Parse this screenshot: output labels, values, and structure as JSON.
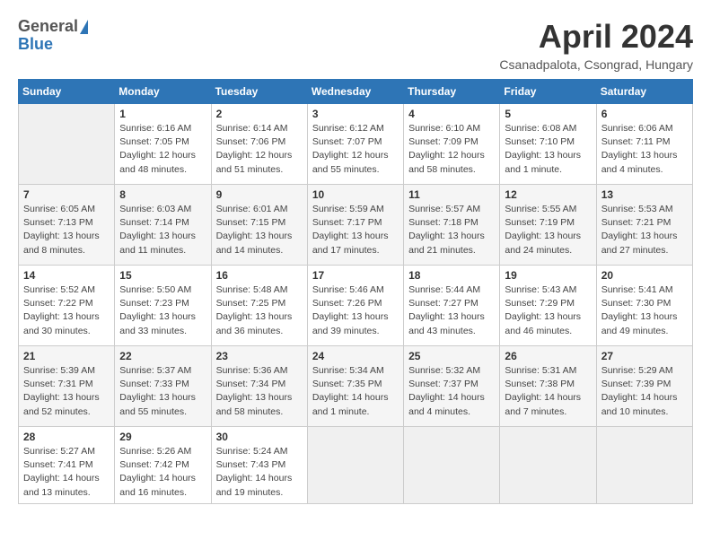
{
  "header": {
    "logo_general": "General",
    "logo_blue": "Blue",
    "month_title": "April 2024",
    "location": "Csanadpalota, Csongrad, Hungary"
  },
  "weekdays": [
    "Sunday",
    "Monday",
    "Tuesday",
    "Wednesday",
    "Thursday",
    "Friday",
    "Saturday"
  ],
  "weeks": [
    [
      {
        "day": "",
        "info": ""
      },
      {
        "day": "1",
        "info": "Sunrise: 6:16 AM\nSunset: 7:05 PM\nDaylight: 12 hours\nand 48 minutes."
      },
      {
        "day": "2",
        "info": "Sunrise: 6:14 AM\nSunset: 7:06 PM\nDaylight: 12 hours\nand 51 minutes."
      },
      {
        "day": "3",
        "info": "Sunrise: 6:12 AM\nSunset: 7:07 PM\nDaylight: 12 hours\nand 55 minutes."
      },
      {
        "day": "4",
        "info": "Sunrise: 6:10 AM\nSunset: 7:09 PM\nDaylight: 12 hours\nand 58 minutes."
      },
      {
        "day": "5",
        "info": "Sunrise: 6:08 AM\nSunset: 7:10 PM\nDaylight: 13 hours\nand 1 minute."
      },
      {
        "day": "6",
        "info": "Sunrise: 6:06 AM\nSunset: 7:11 PM\nDaylight: 13 hours\nand 4 minutes."
      }
    ],
    [
      {
        "day": "7",
        "info": "Sunrise: 6:05 AM\nSunset: 7:13 PM\nDaylight: 13 hours\nand 8 minutes."
      },
      {
        "day": "8",
        "info": "Sunrise: 6:03 AM\nSunset: 7:14 PM\nDaylight: 13 hours\nand 11 minutes."
      },
      {
        "day": "9",
        "info": "Sunrise: 6:01 AM\nSunset: 7:15 PM\nDaylight: 13 hours\nand 14 minutes."
      },
      {
        "day": "10",
        "info": "Sunrise: 5:59 AM\nSunset: 7:17 PM\nDaylight: 13 hours\nand 17 minutes."
      },
      {
        "day": "11",
        "info": "Sunrise: 5:57 AM\nSunset: 7:18 PM\nDaylight: 13 hours\nand 21 minutes."
      },
      {
        "day": "12",
        "info": "Sunrise: 5:55 AM\nSunset: 7:19 PM\nDaylight: 13 hours\nand 24 minutes."
      },
      {
        "day": "13",
        "info": "Sunrise: 5:53 AM\nSunset: 7:21 PM\nDaylight: 13 hours\nand 27 minutes."
      }
    ],
    [
      {
        "day": "14",
        "info": "Sunrise: 5:52 AM\nSunset: 7:22 PM\nDaylight: 13 hours\nand 30 minutes."
      },
      {
        "day": "15",
        "info": "Sunrise: 5:50 AM\nSunset: 7:23 PM\nDaylight: 13 hours\nand 33 minutes."
      },
      {
        "day": "16",
        "info": "Sunrise: 5:48 AM\nSunset: 7:25 PM\nDaylight: 13 hours\nand 36 minutes."
      },
      {
        "day": "17",
        "info": "Sunrise: 5:46 AM\nSunset: 7:26 PM\nDaylight: 13 hours\nand 39 minutes."
      },
      {
        "day": "18",
        "info": "Sunrise: 5:44 AM\nSunset: 7:27 PM\nDaylight: 13 hours\nand 43 minutes."
      },
      {
        "day": "19",
        "info": "Sunrise: 5:43 AM\nSunset: 7:29 PM\nDaylight: 13 hours\nand 46 minutes."
      },
      {
        "day": "20",
        "info": "Sunrise: 5:41 AM\nSunset: 7:30 PM\nDaylight: 13 hours\nand 49 minutes."
      }
    ],
    [
      {
        "day": "21",
        "info": "Sunrise: 5:39 AM\nSunset: 7:31 PM\nDaylight: 13 hours\nand 52 minutes."
      },
      {
        "day": "22",
        "info": "Sunrise: 5:37 AM\nSunset: 7:33 PM\nDaylight: 13 hours\nand 55 minutes."
      },
      {
        "day": "23",
        "info": "Sunrise: 5:36 AM\nSunset: 7:34 PM\nDaylight: 13 hours\nand 58 minutes."
      },
      {
        "day": "24",
        "info": "Sunrise: 5:34 AM\nSunset: 7:35 PM\nDaylight: 14 hours\nand 1 minute."
      },
      {
        "day": "25",
        "info": "Sunrise: 5:32 AM\nSunset: 7:37 PM\nDaylight: 14 hours\nand 4 minutes."
      },
      {
        "day": "26",
        "info": "Sunrise: 5:31 AM\nSunset: 7:38 PM\nDaylight: 14 hours\nand 7 minutes."
      },
      {
        "day": "27",
        "info": "Sunrise: 5:29 AM\nSunset: 7:39 PM\nDaylight: 14 hours\nand 10 minutes."
      }
    ],
    [
      {
        "day": "28",
        "info": "Sunrise: 5:27 AM\nSunset: 7:41 PM\nDaylight: 14 hours\nand 13 minutes."
      },
      {
        "day": "29",
        "info": "Sunrise: 5:26 AM\nSunset: 7:42 PM\nDaylight: 14 hours\nand 16 minutes."
      },
      {
        "day": "30",
        "info": "Sunrise: 5:24 AM\nSunset: 7:43 PM\nDaylight: 14 hours\nand 19 minutes."
      },
      {
        "day": "",
        "info": ""
      },
      {
        "day": "",
        "info": ""
      },
      {
        "day": "",
        "info": ""
      },
      {
        "day": "",
        "info": ""
      }
    ]
  ]
}
